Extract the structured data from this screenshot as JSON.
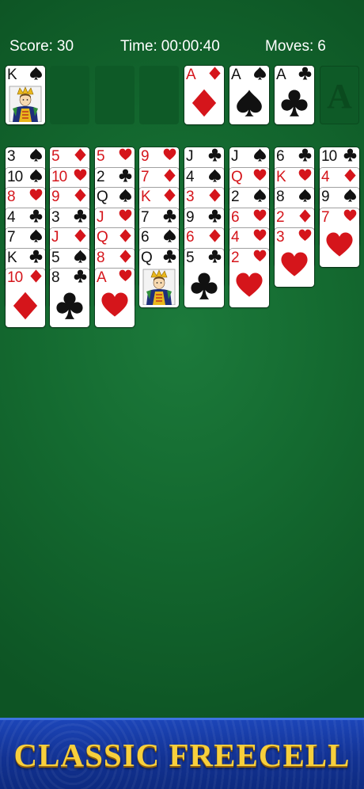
{
  "header": {
    "score_label": "Score:",
    "score_value": "30",
    "time_label": "Time:",
    "time_value": "00:00:40",
    "moves_label": "Moves:",
    "moves_value": "6"
  },
  "free_cells": [
    {
      "rank": "K",
      "suit": "spades",
      "face": true
    },
    null,
    null,
    null
  ],
  "foundations": [
    {
      "rank": "A",
      "suit": "diamonds"
    },
    {
      "rank": "A",
      "suit": "spades"
    },
    {
      "rank": "A",
      "suit": "clubs"
    },
    {
      "rank": "",
      "placeholder": "A"
    }
  ],
  "tableau": [
    [
      {
        "rank": "3",
        "suit": "spades"
      },
      {
        "rank": "10",
        "suit": "spades"
      },
      {
        "rank": "8",
        "suit": "hearts"
      },
      {
        "rank": "4",
        "suit": "clubs"
      },
      {
        "rank": "7",
        "suit": "spades"
      },
      {
        "rank": "K",
        "suit": "clubs"
      },
      {
        "rank": "10",
        "suit": "diamonds"
      }
    ],
    [
      {
        "rank": "5",
        "suit": "diamonds"
      },
      {
        "rank": "10",
        "suit": "hearts"
      },
      {
        "rank": "9",
        "suit": "diamonds"
      },
      {
        "rank": "3",
        "suit": "clubs"
      },
      {
        "rank": "J",
        "suit": "diamonds"
      },
      {
        "rank": "5",
        "suit": "spades"
      },
      {
        "rank": "8",
        "suit": "clubs"
      }
    ],
    [
      {
        "rank": "5",
        "suit": "hearts"
      },
      {
        "rank": "2",
        "suit": "clubs"
      },
      {
        "rank": "Q",
        "suit": "spades"
      },
      {
        "rank": "J",
        "suit": "hearts"
      },
      {
        "rank": "Q",
        "suit": "diamonds"
      },
      {
        "rank": "8",
        "suit": "diamonds"
      },
      {
        "rank": "A",
        "suit": "hearts"
      }
    ],
    [
      {
        "rank": "9",
        "suit": "hearts"
      },
      {
        "rank": "7",
        "suit": "diamonds"
      },
      {
        "rank": "K",
        "suit": "diamonds"
      },
      {
        "rank": "7",
        "suit": "clubs"
      },
      {
        "rank": "6",
        "suit": "spades"
      },
      {
        "rank": "Q",
        "suit": "clubs",
        "face": true
      }
    ],
    [
      {
        "rank": "J",
        "suit": "clubs"
      },
      {
        "rank": "4",
        "suit": "spades"
      },
      {
        "rank": "3",
        "suit": "diamonds"
      },
      {
        "rank": "9",
        "suit": "clubs"
      },
      {
        "rank": "6",
        "suit": "diamonds"
      },
      {
        "rank": "5",
        "suit": "clubs"
      }
    ],
    [
      {
        "rank": "J",
        "suit": "spades"
      },
      {
        "rank": "Q",
        "suit": "hearts"
      },
      {
        "rank": "2",
        "suit": "spades"
      },
      {
        "rank": "6",
        "suit": "hearts"
      },
      {
        "rank": "4",
        "suit": "hearts"
      },
      {
        "rank": "2",
        "suit": "hearts"
      }
    ],
    [
      {
        "rank": "6",
        "suit": "clubs"
      },
      {
        "rank": "K",
        "suit": "hearts"
      },
      {
        "rank": "8",
        "suit": "spades"
      },
      {
        "rank": "2",
        "suit": "diamonds"
      },
      {
        "rank": "3",
        "suit": "hearts"
      }
    ],
    [
      {
        "rank": "10",
        "suit": "clubs"
      },
      {
        "rank": "4",
        "suit": "diamonds"
      },
      {
        "rank": "9",
        "suit": "spades"
      },
      {
        "rank": "7",
        "suit": "hearts"
      }
    ]
  ],
  "banner": {
    "title": "CLASSIC FREECELL"
  },
  "colors": {
    "felt": "#146a30",
    "red_suit": "#d5151b",
    "black_suit": "#111111",
    "banner_blue": "#123293",
    "banner_gold": "#f7cf3c"
  }
}
